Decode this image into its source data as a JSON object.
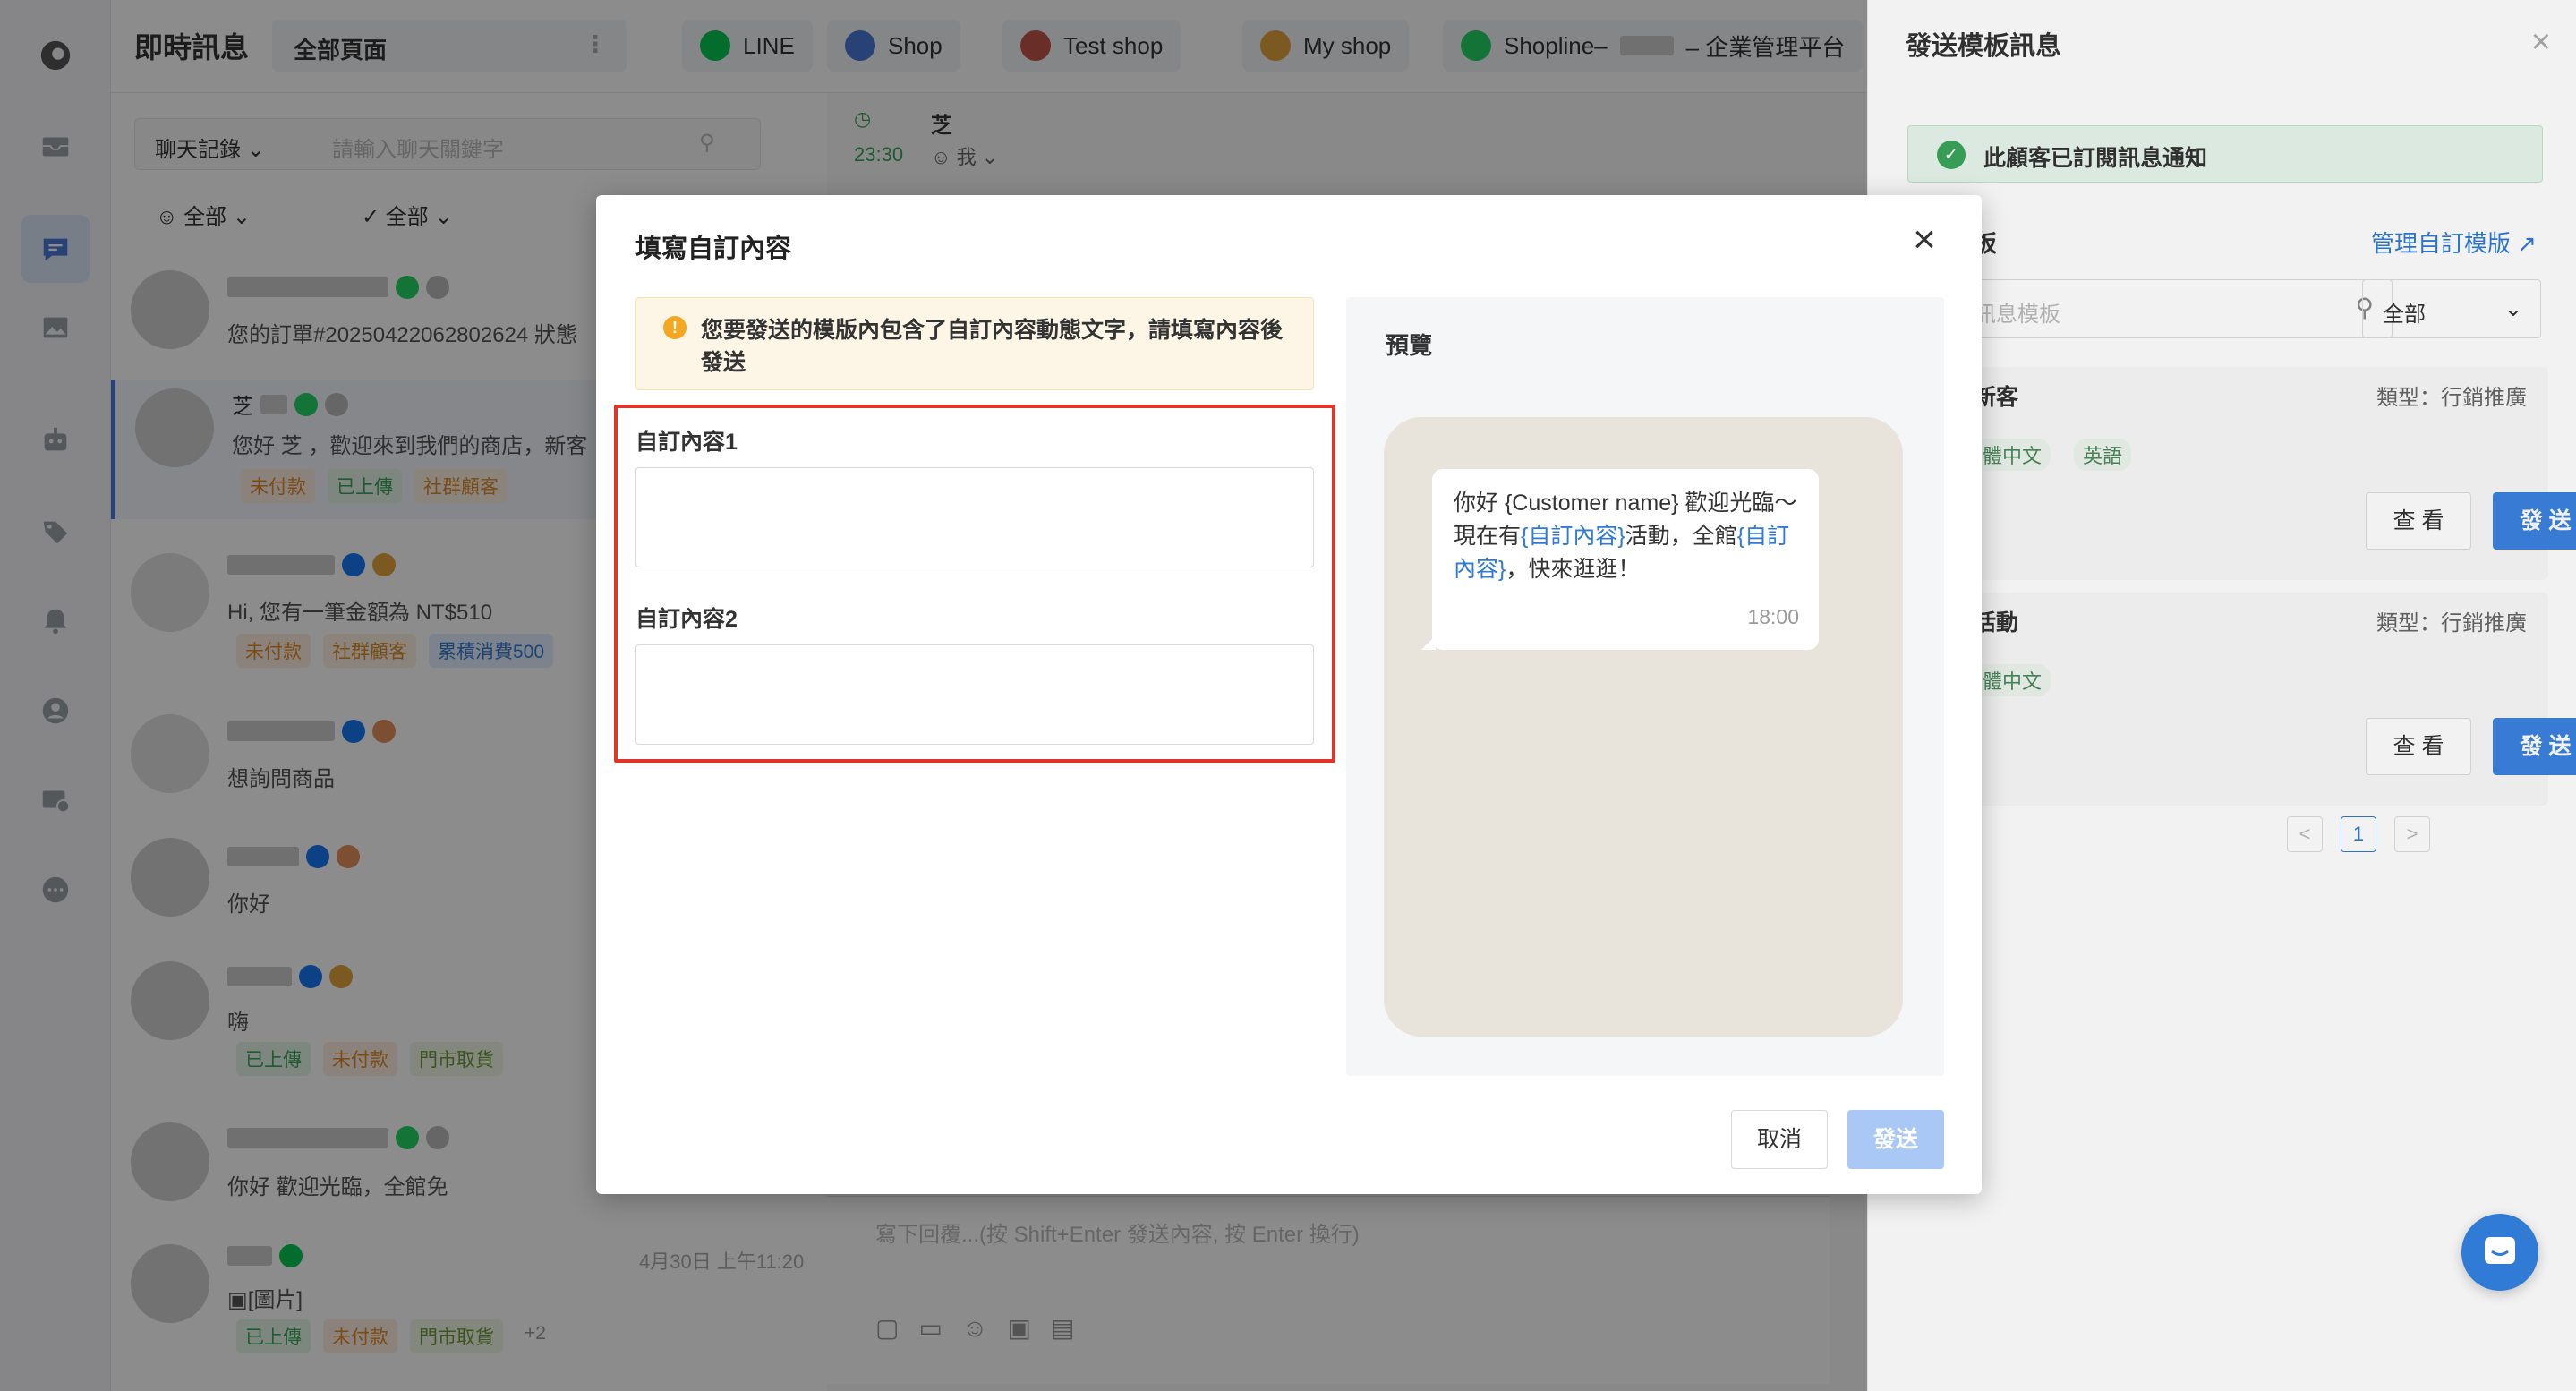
{
  "app": {
    "title": "即時訊息",
    "page_select": "全部頁面"
  },
  "channel_tabs": [
    {
      "label": "LINE",
      "icon": "line-icon",
      "color": "#06c755"
    },
    {
      "label": "Shop",
      "icon": "shop-icon",
      "color": "#4a78d6"
    },
    {
      "label": "Test shop",
      "icon": "test-shop-icon",
      "color": "#c2554b"
    },
    {
      "label": "My shop",
      "icon": "my-shop-icon",
      "color": "#e2a33b"
    },
    {
      "label_prefix": "Shopline–",
      "label_suffix": "– 企業管理平台",
      "icon": "whatsapp-icon",
      "color": "#25d366"
    }
  ],
  "chat_list": {
    "filter_label": "聊天記錄",
    "search_placeholder": "請輸入聊天關鍵字",
    "assignee_filter": "全部",
    "status_filter": "全部",
    "conversations": [
      {
        "msg": "您的訂單#20250422062802624 狀態",
        "tags": []
      },
      {
        "name": "芝",
        "msg": "您好 芝 ，歡迎來到我們的商店，新客",
        "tags": [
          "未付款",
          "已上傳",
          "社群顧客"
        ]
      },
      {
        "msg": "Hi,                 您有一筆金額為 NT$510",
        "tags": [
          "未付款",
          "社群顧客",
          "累積消費500"
        ]
      },
      {
        "msg": "想詢問商品",
        "tags": []
      },
      {
        "msg": "你好",
        "tags": []
      },
      {
        "msg": "嗨",
        "tags": [
          "已上傳",
          "未付款",
          "門市取貨"
        ]
      },
      {
        "msg": "你好                    歡迎光臨，全館免",
        "tags": []
      },
      {
        "msg": "[圖片]",
        "time": "4月30日 上午11:20",
        "tags": [
          "已上傳",
          "未付款",
          "門市取貨"
        ],
        "more": "+2"
      }
    ]
  },
  "chat": {
    "time": "23:30",
    "contact": "芝",
    "assignee": "我",
    "input_placeholder": "寫下回覆...(按 Shift+Enter 發送內容, 按 Enter 換行)"
  },
  "modal": {
    "title": "填寫自訂內容",
    "notice": "您要發送的模版內包含了自訂內容動態文字，請填寫內容後發送",
    "fields": [
      {
        "label": "自訂內容1",
        "value": ""
      },
      {
        "label": "自訂內容2",
        "value": ""
      }
    ],
    "preview_title": "預覽",
    "preview_message": {
      "t1": "你好 {Customer name} 歡迎光臨～現在有",
      "v1": "{自訂內容}",
      "t2": "活動，全館",
      "v2": "{自訂內容}",
      "t3": "，快來逛逛！",
      "time": "18:00"
    },
    "cancel": "取消",
    "send": "發送"
  },
  "right_panel": {
    "title": "發送模板訊息",
    "subscribed_notice": "此顧客已訂閱訊息通知",
    "section_label": "板",
    "manage_link": "管理自訂模版",
    "search_placeholder": "訊息模板",
    "category_select": "全部",
    "templates": [
      {
        "name": "新客",
        "type": "類型：行銷推廣",
        "langs": [
          "體中文",
          "英語"
        ],
        "view": "查 看",
        "send": "發 送"
      },
      {
        "name": "活動",
        "type": "類型：行銷推廣",
        "langs": [
          "體中文"
        ],
        "view": "查 看",
        "send": "發 送"
      }
    ],
    "pagination": {
      "prev": "<",
      "page": "1",
      "next": ">"
    }
  }
}
